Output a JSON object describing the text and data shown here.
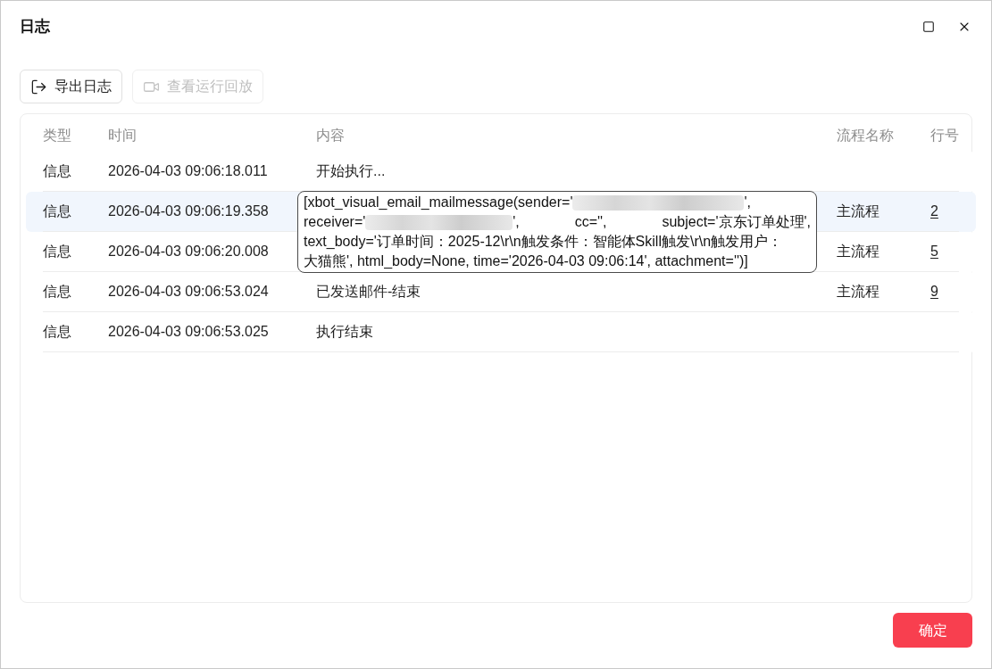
{
  "window": {
    "title": "日志"
  },
  "toolbar": {
    "buttons": [
      {
        "label": "导出日志",
        "kind": "export",
        "disabled": false
      },
      {
        "label": "查看运行回放",
        "kind": "replay",
        "disabled": true
      }
    ]
  },
  "table": {
    "columns": [
      "类型",
      "时间",
      "内容",
      "流程名称",
      "行号"
    ],
    "rows": [
      {
        "type": "信息",
        "time": "2026-04-03 09:06:18.011",
        "content": "开始执行...",
        "selected": false
      },
      {
        "type": "信息",
        "time": "2026-04-03 09:06:19.358",
        "flow": "主流程",
        "line": "2",
        "selected": true
      },
      {
        "type": "信息",
        "time": "2026-04-03 09:06:20.008",
        "flow": "主流程",
        "line": "5",
        "selected": false
      },
      {
        "type": "信息",
        "time": "2026-04-03 09:06:53.024",
        "content": "已发送邮件-结束",
        "flow": "主流程",
        "line": "9",
        "selected": false
      },
      {
        "type": "信息",
        "time": "2026-04-03 09:06:53.025",
        "content": "执行结束",
        "selected": false
      }
    ]
  },
  "tooltip": {
    "lines": [
      {
        "chunks": [
          [
            {
              "kind": "text",
              "text": "[xbot_visual_email_mailmessage(sender='"
            },
            {
              "kind": "redacted"
            },
            {
              "kind": "text",
              "text": "',"
            }
          ]
        ]
      },
      {
        "chunks": [
          [
            {
              "kind": "text",
              "text": "receiver='"
            },
            {
              "kind": "redacted"
            },
            {
              "kind": "text",
              "text": "',"
            }
          ],
          [
            {
              "kind": "text",
              "text": "cc='',"
            }
          ],
          [
            {
              "kind": "text",
              "text": "subject='京东订单处理',"
            }
          ]
        ]
      },
      {
        "chunks": [
          [
            {
              "kind": "text",
              "text": "text_body='订单时间：2025-12\\r\\n触发条件：智能体Skill触发\\r\\n触发用户："
            }
          ]
        ]
      },
      {
        "chunks": [
          [
            {
              "kind": "text",
              "text": "大猫熊', html_body=None, time='2026-04-03 09:06:14', attachment='')]"
            }
          ]
        ]
      }
    ]
  },
  "footer": {
    "confirm": "确定"
  }
}
